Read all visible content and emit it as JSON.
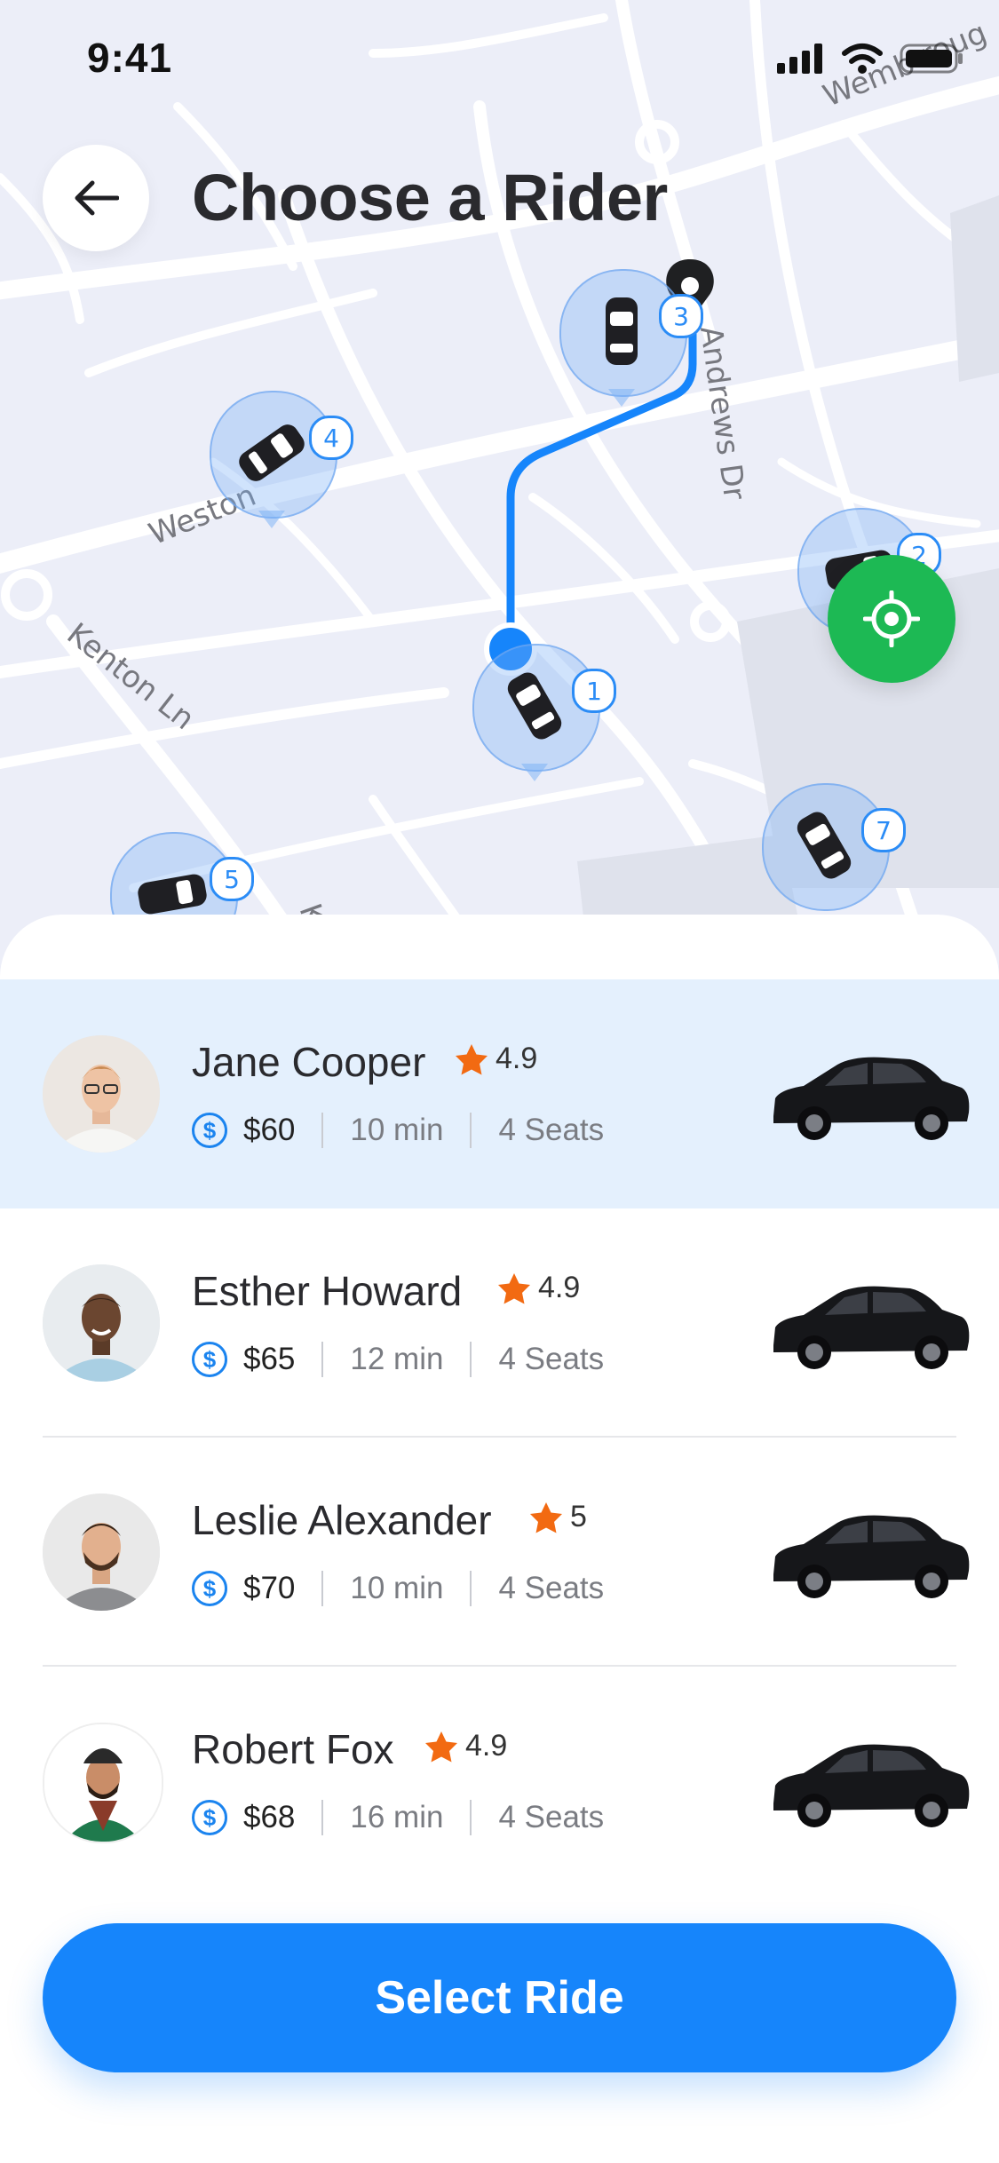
{
  "status_bar": {
    "time": "9:41"
  },
  "header": {
    "title": "Choose a Rider"
  },
  "map": {
    "streets": [
      "Weston",
      "Kenton Ln",
      "Andrews Dr",
      "Wemb",
      "roug",
      "K"
    ],
    "drivers": [
      {
        "badge": "1"
      },
      {
        "badge": "2"
      },
      {
        "badge": "4"
      },
      {
        "badge": "5"
      },
      {
        "badge": "7"
      },
      {
        "badge": "3"
      }
    ]
  },
  "riders": [
    {
      "name": "Jane Cooper",
      "rating": "4.9",
      "price": "$60",
      "time": "10 min",
      "seats": "4 Seats",
      "selected": true
    },
    {
      "name": "Esther Howard",
      "rating": "4.9",
      "price": "$65",
      "time": "12 min",
      "seats": "4 Seats",
      "selected": false
    },
    {
      "name": "Leslie Alexander",
      "rating": "5",
      "price": "$70",
      "time": "10 min",
      "seats": "4 Seats",
      "selected": false
    },
    {
      "name": "Robert Fox",
      "rating": "4.9",
      "price": "$68",
      "time": "16 min",
      "seats": "4 Seats",
      "selected": false
    }
  ],
  "cta": {
    "label": "Select Ride"
  },
  "colors": {
    "primary": "#1685fb",
    "locate": "#1db954",
    "star": "#f26a12",
    "selected_row": "#e4f0fd"
  }
}
